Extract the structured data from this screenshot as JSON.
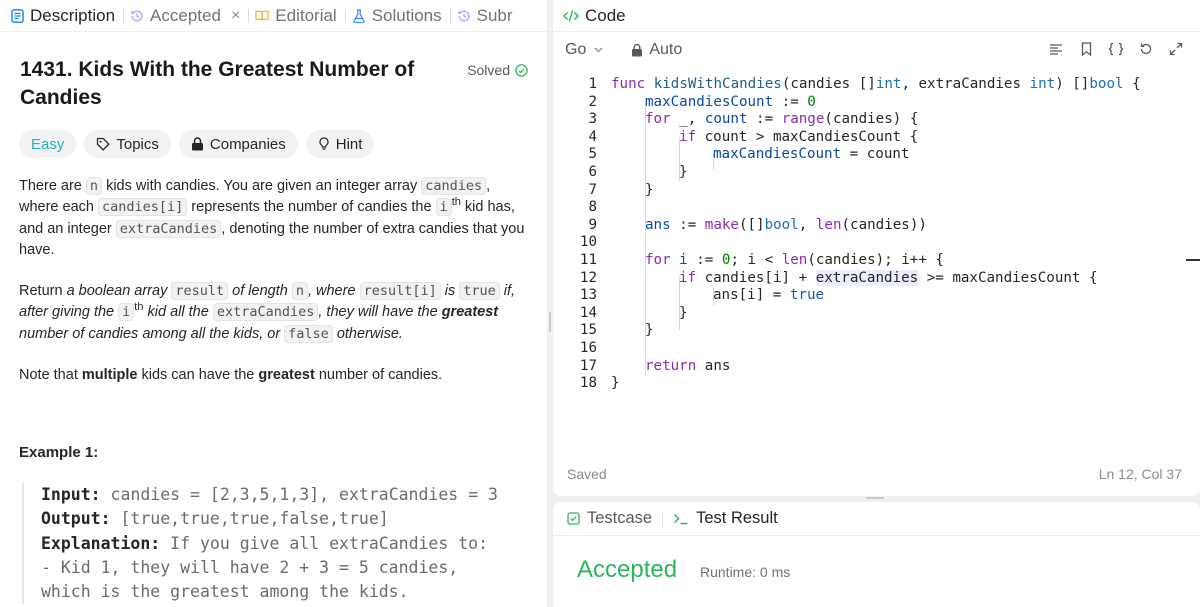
{
  "tabs": [
    {
      "label": "Description",
      "icon": "description-icon",
      "active": true
    },
    {
      "label": "Accepted",
      "icon": "history-icon",
      "closable": true
    },
    {
      "label": "Editorial",
      "icon": "book-icon"
    },
    {
      "label": "Solutions",
      "icon": "flask-icon"
    },
    {
      "label": "Subr",
      "icon": "history-icon"
    }
  ],
  "close_glyph": "×",
  "problem": {
    "title": "1431. Kids With the Greatest Number of Candies",
    "status": "Solved",
    "difficulty": "Easy",
    "chips": [
      "Topics",
      "Companies",
      "Hint"
    ]
  },
  "description": {
    "p1": [
      "There are ",
      "n",
      " kids with candies. You are given an integer array ",
      "candies",
      ", where each ",
      "candies[i]",
      " represents the number of candies the ",
      "i",
      "th",
      " kid has, and an integer ",
      "extraCandies",
      ", denoting the number of extra candies that you have."
    ],
    "p2": [
      "Return ",
      "a boolean array ",
      "result",
      " of length ",
      "n",
      ", where ",
      "result[i]",
      " is ",
      "true",
      " if, after giving the ",
      "i",
      "th",
      " kid all the ",
      "extraCandies",
      ", they will have the ",
      "greatest",
      " number of candies among all the kids, or ",
      "false",
      " otherwise."
    ],
    "p3": [
      "Note that ",
      "multiple",
      " kids can have the ",
      "greatest",
      " number of candies."
    ]
  },
  "example": {
    "title": "Example 1:",
    "input_label": "Input:",
    "input": " candies = [2,3,5,1,3], extraCandies = 3",
    "output_label": "Output:",
    "output": " [true,true,true,false,true]",
    "explanation_label": "Explanation:",
    "explanation": " If you give all extraCandies to:",
    "line4": "- Kid 1, they will have 2 + 3 = 5 candies,",
    "line5": "which is the greatest among the kids."
  },
  "code_panel": {
    "title": "Code",
    "language": "Go",
    "mode": "Auto",
    "status": "Saved",
    "cursor": "Ln 12, Col 37"
  },
  "code_lines": [
    "1",
    "2",
    "3",
    "4",
    "5",
    "6",
    "7",
    "8",
    "9",
    "10",
    "11",
    "12",
    "13",
    "14",
    "15",
    "16",
    "17",
    "18"
  ],
  "code_tokens": {
    "l1": [
      "func",
      " ",
      "kidsWithCandies",
      "(candies []",
      "int",
      ", extraCandies ",
      "int",
      ") []",
      "bool",
      " {"
    ],
    "l2": [
      "maxCandiesCount",
      " := ",
      "0"
    ],
    "l3": [
      "for",
      " _, ",
      "count",
      " := ",
      "range",
      "(candies) {"
    ],
    "l4": [
      "if",
      " count > maxCandiesCount {"
    ],
    "l5": [
      "maxCandiesCount",
      " = count"
    ],
    "l6": [
      "}"
    ],
    "l7": [
      "}"
    ],
    "l9": [
      "ans",
      " := ",
      "make",
      "([]",
      "bool",
      ", ",
      "len",
      "(candies))"
    ],
    "l11": [
      "for",
      " ",
      "i",
      " := ",
      "0",
      "; i < ",
      "len",
      "(candies); i++ {"
    ],
    "l12": [
      "if",
      " candies[i] + ",
      "extraCandies",
      " >= maxCandiesCount {"
    ],
    "l13": [
      "ans[i] = ",
      "true"
    ],
    "l14": [
      "}"
    ],
    "l15": [
      "}"
    ],
    "l17": [
      "return",
      " ans"
    ],
    "l18": [
      "}"
    ]
  },
  "bottom": {
    "tab1": "Testcase",
    "tab2": "Test Result",
    "result": "Accepted",
    "runtime": "Runtime: 0 ms"
  },
  "colors": {
    "accepted": "#2db55d",
    "easy": "#1cb8b8",
    "keyword": "#8b2bb0",
    "type": "#1a6fb5"
  }
}
